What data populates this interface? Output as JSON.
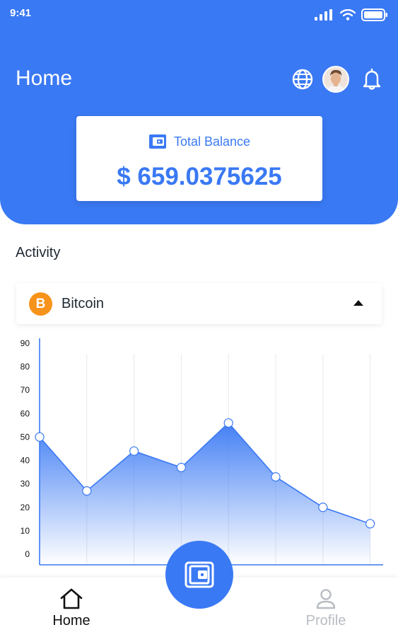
{
  "status_bar": {
    "time": "9:41"
  },
  "header": {
    "title": "Home"
  },
  "balance": {
    "label": "Total Balance",
    "value": "$ 659.0375625"
  },
  "activity": {
    "title": "Activity",
    "selected_coin": {
      "name": "Bitcoin",
      "symbol": "B"
    }
  },
  "chart_data": {
    "type": "area",
    "x": [
      1,
      2,
      3,
      4,
      5,
      6,
      7,
      8
    ],
    "values": [
      50,
      27,
      44,
      37,
      56,
      33,
      20,
      13
    ],
    "ylim": [
      0,
      90
    ],
    "yticks": [
      "0",
      "10",
      "20",
      "30",
      "40",
      "50",
      "60",
      "70",
      "80",
      "90"
    ],
    "grid": "vertical",
    "color": "#3a79f4"
  },
  "nav": {
    "home_label": "Home",
    "profile_label": "Profile"
  },
  "colors": {
    "accent": "#3a79f4",
    "bitcoin": "#f7931a",
    "inactive": "#b8bcc2"
  },
  "icons": [
    "globe-icon",
    "bell-icon",
    "wallet-icon",
    "home-icon",
    "user-icon",
    "signal-icon",
    "wifi-icon",
    "battery-icon"
  ]
}
